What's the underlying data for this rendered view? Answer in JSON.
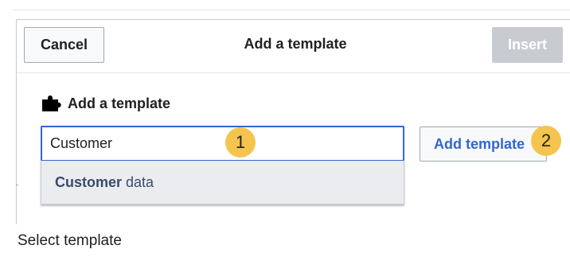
{
  "dialog": {
    "title": "Add a template",
    "cancel_label": "Cancel",
    "insert_label": "Insert"
  },
  "form": {
    "label": "Add a template",
    "label_icon": "puzzle-icon",
    "search_value": "Customer",
    "add_template_label": "Add template"
  },
  "suggestions": [
    {
      "match": "Customer",
      "rest": " data"
    }
  ],
  "annotations": {
    "badge_1": "1",
    "badge_2": "2",
    "badge_color": "#f5c44e"
  },
  "caption": "Select template",
  "colors": {
    "accent": "#3366cc",
    "insert_disabled": "#c8ccd1",
    "suggestion_bg": "#eaecf0"
  }
}
